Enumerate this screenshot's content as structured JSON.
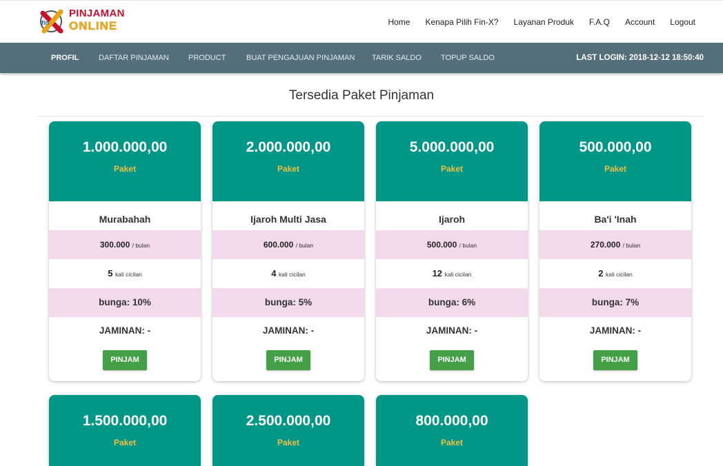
{
  "brand": {
    "line1": "PINJAMAN",
    "line2": "ONLINE",
    "logo_icon": "fin-x-logo-icon"
  },
  "top_nav": [
    "Home",
    "Kenapa Pilih Fin-X?",
    "Layanan Produk",
    "F.A.Q",
    "Account",
    "Logout"
  ],
  "main_nav": {
    "items": [
      "PROFIL",
      "DAFTAR PINJAMAN",
      "PRODUCT",
      "BUAT PENGAJUAN PINJAMAN",
      "TARIK SALDO",
      "TOPUP SALDO"
    ],
    "active": "PROFIL",
    "last_login": "LAST LOGIN: 2018-12-12 18:50:40"
  },
  "heading": "Tersedia Paket Pinjaman",
  "colors": {
    "header": "#009688",
    "nav": "#546e7a",
    "button": "#43a047",
    "pink_row": "#f3d9ec",
    "paket_label": "#f2c040"
  },
  "packages": [
    {
      "amount": "1.000.000,00",
      "label": "Paket",
      "name": "Murabahah",
      "cicilan": "300.000",
      "cicilan_unit": "/ bulan",
      "tenor": "5",
      "tenor_unit": "kali cicilan",
      "bunga": "bunga: 10%",
      "jaminan": "JAMINAN: -",
      "button": "PINJAM"
    },
    {
      "amount": "2.000.000,00",
      "label": "Paket",
      "name": "Ijaroh Multi Jasa",
      "cicilan": "600.000",
      "cicilan_unit": "/ bulan",
      "tenor": "4",
      "tenor_unit": "kali cicilan",
      "bunga": "bunga: 5%",
      "jaminan": "JAMINAN: -",
      "button": "PINJAM"
    },
    {
      "amount": "5.000.000,00",
      "label": "Paket",
      "name": "Ijaroh",
      "cicilan": "500.000",
      "cicilan_unit": "/ bulan",
      "tenor": "12",
      "tenor_unit": "kali cicilan",
      "bunga": "bunga: 6%",
      "jaminan": "JAMINAN: -",
      "button": "PINJAM"
    },
    {
      "amount": "500.000,00",
      "label": "Paket",
      "name": "Ba'i 'Inah",
      "cicilan": "270.000",
      "cicilan_unit": "/ bulan",
      "tenor": "2",
      "tenor_unit": "kali cicilan",
      "bunga": "bunga: 7%",
      "jaminan": "JAMINAN: -",
      "button": "PINJAM"
    },
    {
      "amount": "1.500.000,00",
      "label": "Paket"
    },
    {
      "amount": "2.500.000,00",
      "label": "Paket"
    },
    {
      "amount": "800.000,00",
      "label": "Paket"
    }
  ]
}
